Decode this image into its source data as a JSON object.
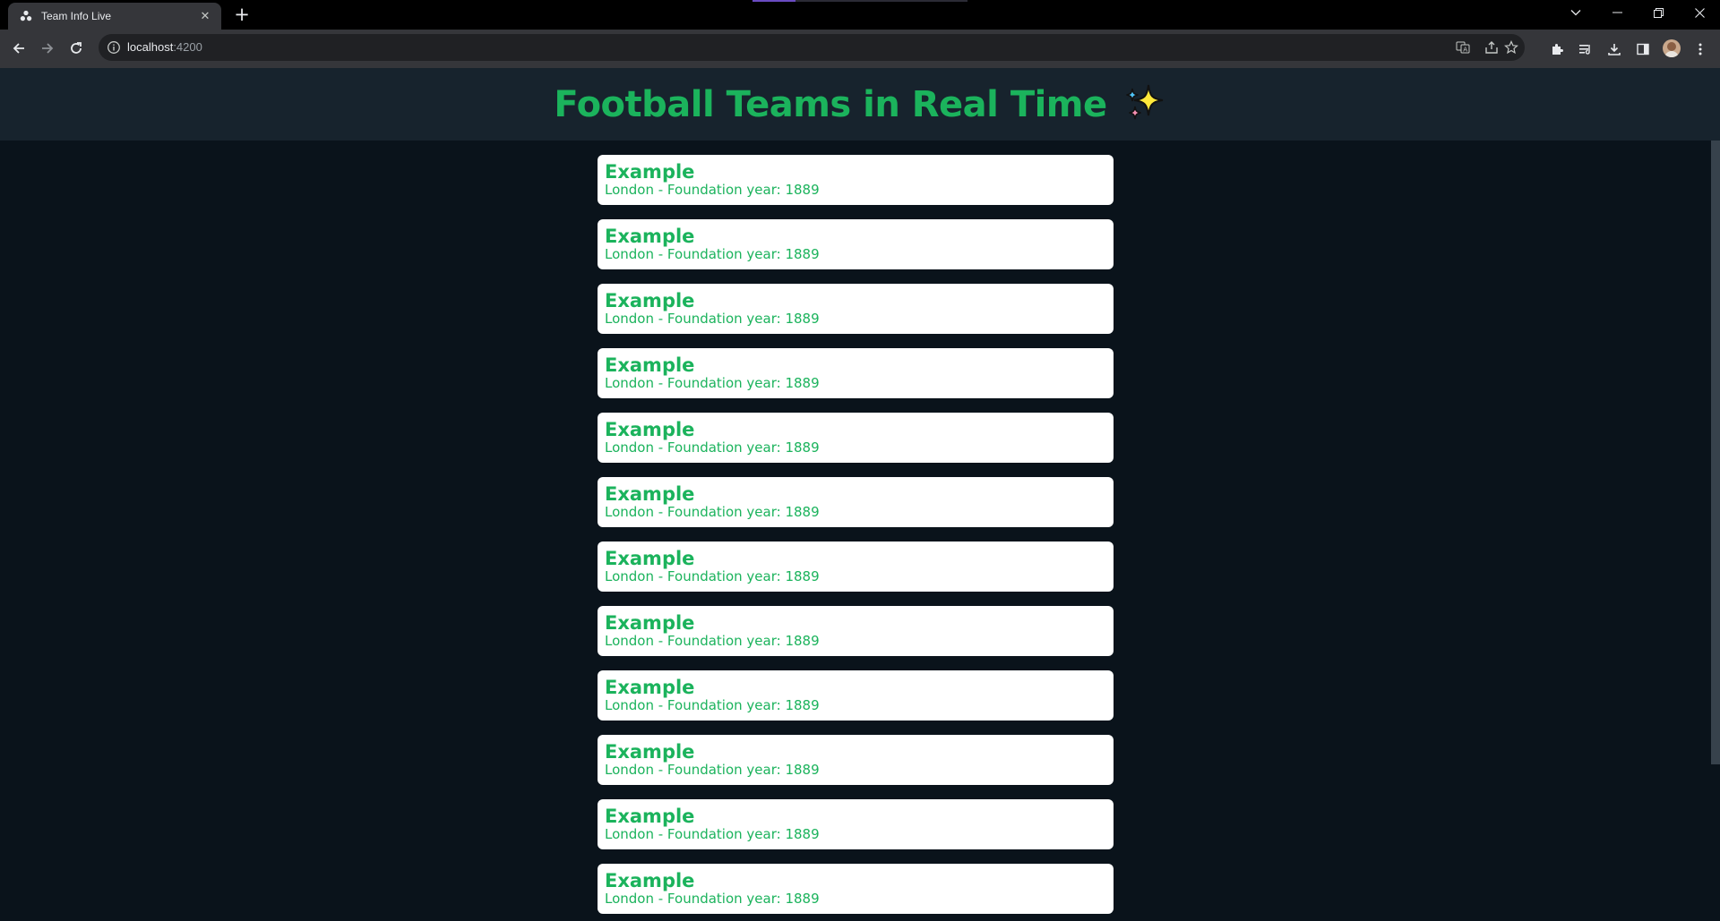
{
  "browser": {
    "tab_title": "Team Info Live",
    "url_host": "localhost",
    "url_port": ":4200"
  },
  "page": {
    "title": "Football Teams in Real Time",
    "title_emoji": "sparkles-icon",
    "accent_color": "#1bb35c"
  },
  "teams": [
    {
      "name": "Example",
      "city": "London",
      "info": "London - Foundation year: 1889",
      "foundation_year": 1889
    },
    {
      "name": "Example",
      "city": "London",
      "info": "London - Foundation year: 1889",
      "foundation_year": 1889
    },
    {
      "name": "Example",
      "city": "London",
      "info": "London - Foundation year: 1889",
      "foundation_year": 1889
    },
    {
      "name": "Example",
      "city": "London",
      "info": "London - Foundation year: 1889",
      "foundation_year": 1889
    },
    {
      "name": "Example",
      "city": "London",
      "info": "London - Foundation year: 1889",
      "foundation_year": 1889
    },
    {
      "name": "Example",
      "city": "London",
      "info": "London - Foundation year: 1889",
      "foundation_year": 1889
    },
    {
      "name": "Example",
      "city": "London",
      "info": "London - Foundation year: 1889",
      "foundation_year": 1889
    },
    {
      "name": "Example",
      "city": "London",
      "info": "London - Foundation year: 1889",
      "foundation_year": 1889
    },
    {
      "name": "Example",
      "city": "London",
      "info": "London - Foundation year: 1889",
      "foundation_year": 1889
    },
    {
      "name": "Example",
      "city": "London",
      "info": "London - Foundation year: 1889",
      "foundation_year": 1889
    },
    {
      "name": "Example",
      "city": "London",
      "info": "London - Foundation year: 1889",
      "foundation_year": 1889
    },
    {
      "name": "Example",
      "city": "London",
      "info": "London - Foundation year: 1889",
      "foundation_year": 1889
    }
  ]
}
